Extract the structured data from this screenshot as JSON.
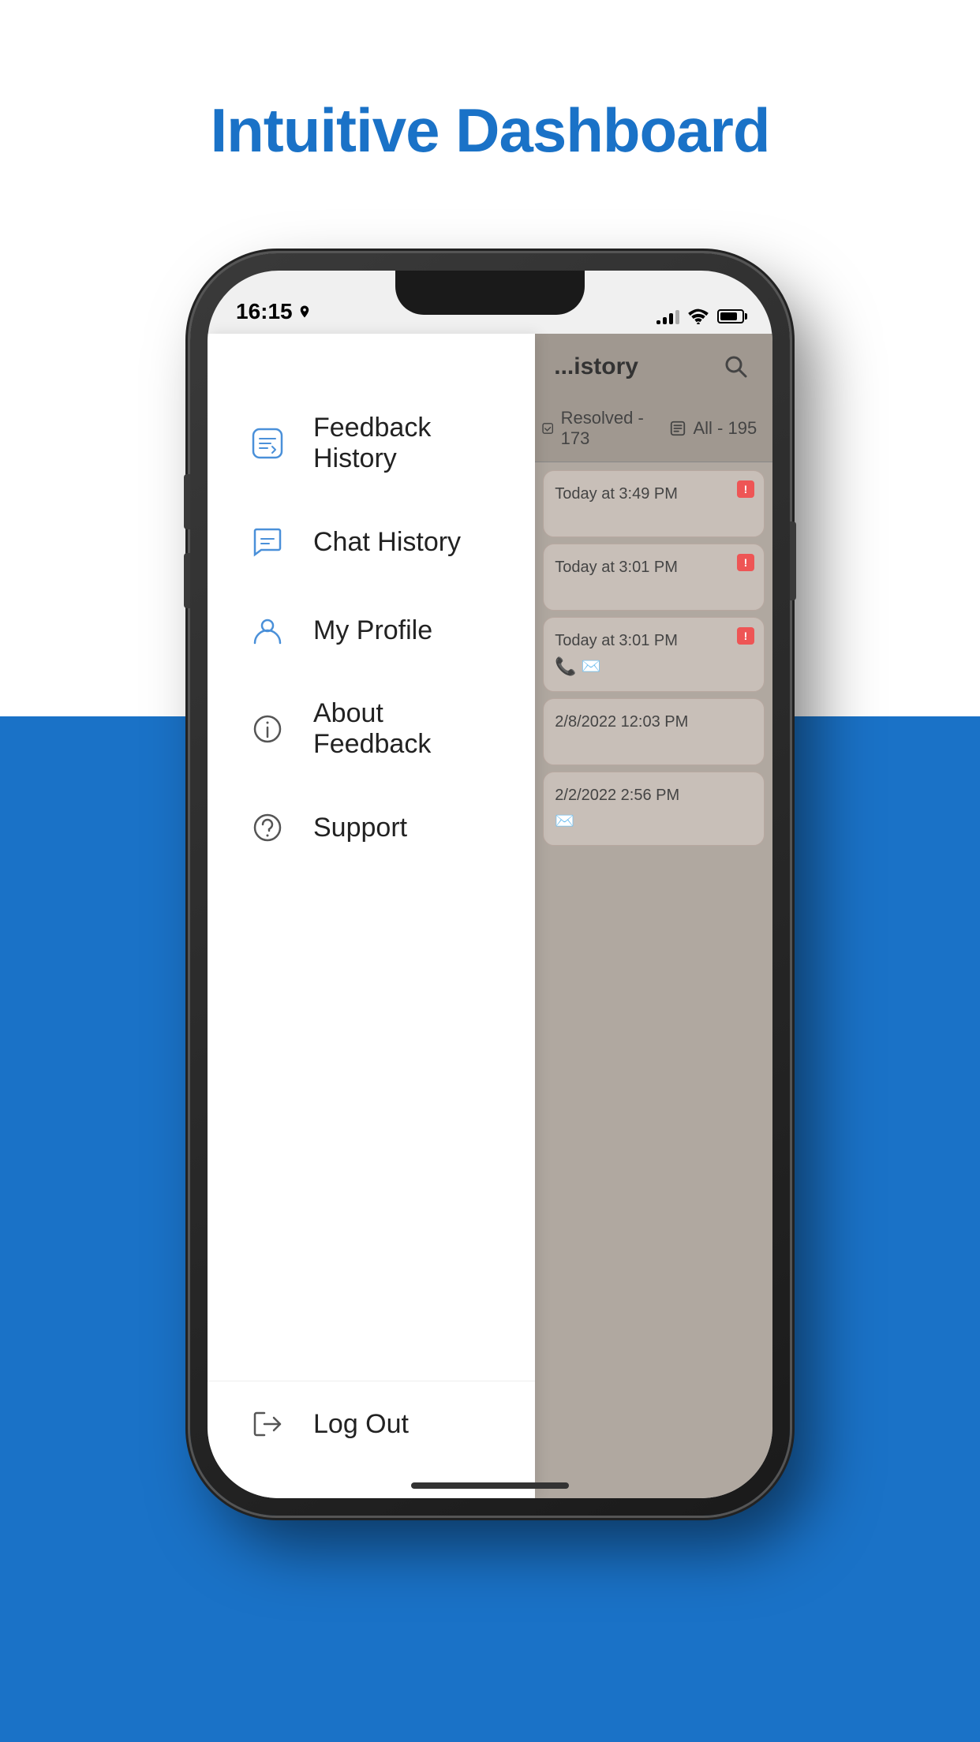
{
  "page": {
    "title": "Intuitive Dashboard"
  },
  "status_bar": {
    "time": "16:15",
    "signal_bars": [
      1,
      2,
      3,
      4
    ],
    "wifi": "wifi",
    "battery": "battery"
  },
  "drawer": {
    "menu_items": [
      {
        "id": "feedback-history",
        "label": "Feedback History",
        "icon": "feedback-history-icon"
      },
      {
        "id": "chat-history",
        "label": "Chat History",
        "icon": "chat-history-icon"
      },
      {
        "id": "my-profile",
        "label": "My Profile",
        "icon": "profile-icon"
      },
      {
        "id": "about-feedback",
        "label": "About Feedback",
        "icon": "info-icon"
      },
      {
        "id": "support",
        "label": "Support",
        "icon": "support-icon"
      }
    ],
    "logout": {
      "label": "Log Out",
      "icon": "logout-icon"
    }
  },
  "app_panel": {
    "header": {
      "title": "...istory",
      "search_label": "search"
    },
    "tabs": [
      {
        "label": "Resolved - 173",
        "icon": "check-icon"
      },
      {
        "label": "All - 195",
        "icon": "list-icon"
      }
    ],
    "cards": [
      {
        "time": "Today at  3:49 PM",
        "has_alert": true,
        "has_phone": false,
        "has_email": false
      },
      {
        "time": "Today at  3:01 PM",
        "has_alert": true,
        "has_phone": false,
        "has_email": false
      },
      {
        "time": "Today at  3:01 PM",
        "has_alert": true,
        "has_phone": true,
        "has_email": true
      },
      {
        "time": "2/8/2022 12:03 PM",
        "has_alert": false,
        "has_phone": false,
        "has_email": false
      },
      {
        "time": "2/2/2022 2:56 PM",
        "has_alert": false,
        "has_phone": false,
        "has_email": true
      }
    ]
  }
}
